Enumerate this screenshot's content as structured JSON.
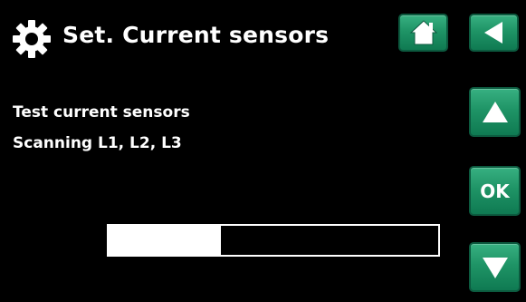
{
  "header": {
    "title": "Set. Current sensors",
    "icon": "gear-icon"
  },
  "nav": {
    "home_icon": "home-icon",
    "back_icon": "back-arrow-icon",
    "up_icon": "up-arrow-icon",
    "ok_label": "OK",
    "down_icon": "down-arrow-icon"
  },
  "content": {
    "line1": "Test current sensors",
    "line2": "Scanning L1, L2, L3"
  },
  "progress": {
    "fraction": 0.34
  },
  "colors": {
    "background": "#000000",
    "button_green": "#1f9466",
    "text": "#ffffff"
  }
}
